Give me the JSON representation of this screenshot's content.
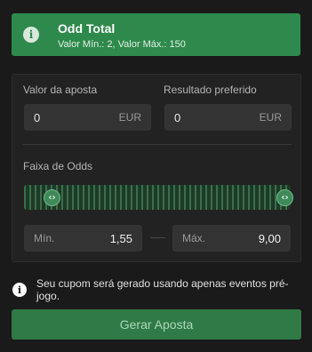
{
  "banner": {
    "title": "Odd Total",
    "subtitle": "Valor Mín.: 2, Valor Máx.: 150",
    "icon": "info-icon"
  },
  "stake": {
    "label": "Valor da aposta",
    "value": "0",
    "currency": "EUR"
  },
  "desired_result": {
    "label": "Resultado preferido",
    "value": "0",
    "currency": "EUR"
  },
  "odds_range": {
    "label": "Faixa de Odds",
    "min_placeholder": "Mín.",
    "min_value": "1,55",
    "max_placeholder": "Máx.",
    "max_value": "9,00",
    "handle_glyph": "‹›"
  },
  "notice": {
    "text": "Seu cupom será gerado usando apenas eventos pré-jogo.",
    "icon": "info-icon"
  },
  "cta": {
    "label": "Gerar Aposta"
  },
  "colors": {
    "accent": "#2e8a4c",
    "button": "#2f7a47",
    "background": "#1a1a1a",
    "panel": "#222222",
    "input": "#333333"
  }
}
